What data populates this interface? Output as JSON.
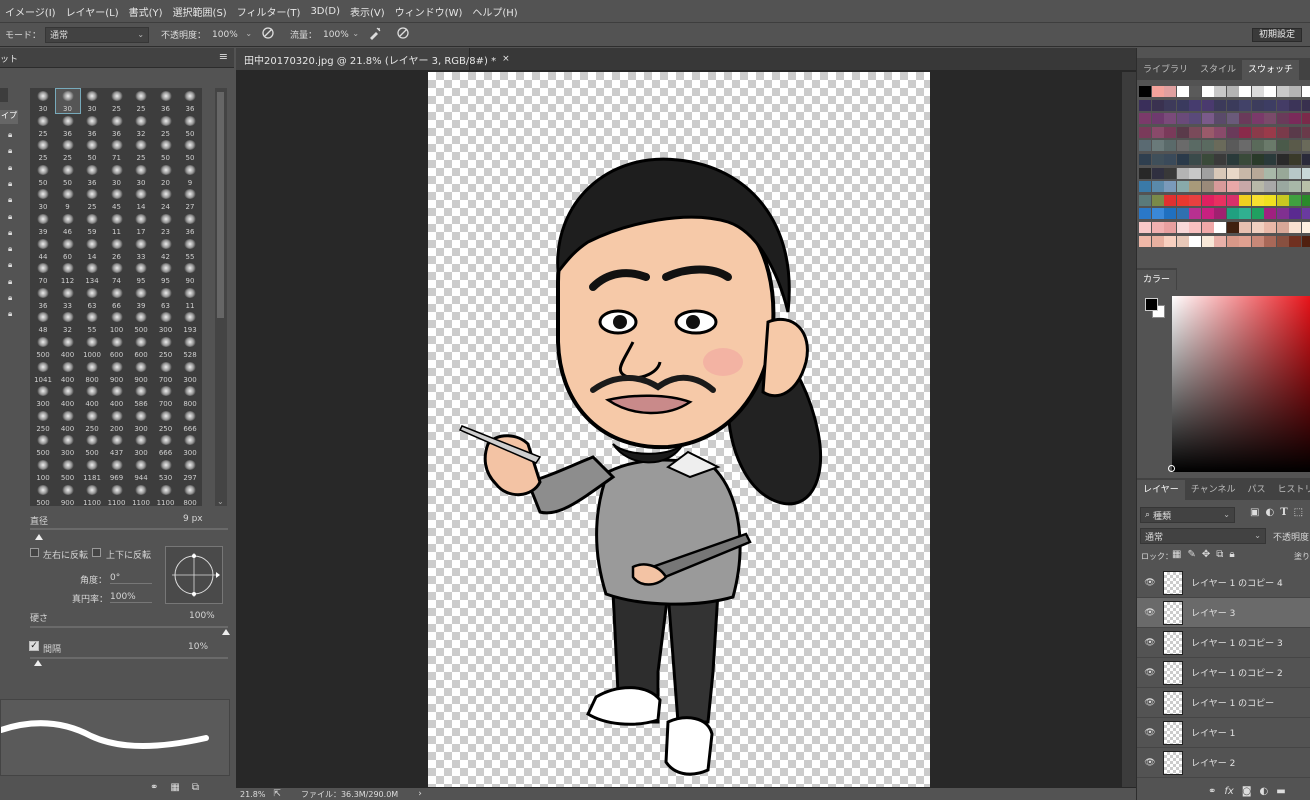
{
  "menu": [
    "イメージ(I)",
    "レイヤー(L)",
    "書式(Y)",
    "選択範囲(S)",
    "フィルター(T)",
    "3D(D)",
    "表示(V)",
    "ウィンドウ(W)",
    "ヘルプ(H)"
  ],
  "options_bar": {
    "mode_label": "モード：",
    "mode_value": "通常",
    "opacity_label": "不透明度：",
    "opacity_value": "100%",
    "flow_label": "流量：",
    "flow_value": "100%",
    "reset_button": "初期設定"
  },
  "document": {
    "tab_title": "田中20170320.jpg @ 21.8% (レイヤー 3, RGB/8#) *",
    "close": "×",
    "zoom": "21.8%",
    "file_info": "ファイル：36.3M/290.0M"
  },
  "brush_panel": {
    "header_left": "ット",
    "sizes": [
      "30",
      "30",
      "30",
      "25",
      "25",
      "36",
      "36",
      "25",
      "36",
      "36",
      "36",
      "32",
      "25",
      "50",
      "25",
      "25",
      "50",
      "71",
      "25",
      "50",
      "50",
      "50",
      "50",
      "36",
      "30",
      "30",
      "20",
      "9",
      "30",
      "9",
      "25",
      "45",
      "14",
      "24",
      "27",
      "39",
      "46",
      "59",
      "11",
      "17",
      "23",
      "36",
      "44",
      "60",
      "14",
      "26",
      "33",
      "42",
      "55",
      "70",
      "112",
      "134",
      "74",
      "95",
      "95",
      "90",
      "36",
      "33",
      "63",
      "66",
      "39",
      "63",
      "11",
      "48",
      "32",
      "55",
      "100",
      "500",
      "300",
      "193",
      "500",
      "400",
      "1000",
      "600",
      "600",
      "250",
      "528",
      "1041",
      "400",
      "800",
      "900",
      "900",
      "700",
      "300",
      "300",
      "400",
      "400",
      "400",
      "586",
      "700",
      "800",
      "250",
      "400",
      "250",
      "200",
      "300",
      "250",
      "666",
      "500",
      "300",
      "500",
      "437",
      "300",
      "666",
      "300",
      "100",
      "500",
      "1181",
      "969",
      "944",
      "530",
      "297",
      "500",
      "900",
      "1100",
      "1100",
      "1100",
      "1100",
      "800"
    ],
    "diameter_label": "直径",
    "diameter_value": "9 px",
    "flip_x_label": "左右に反転",
    "flip_y_label": "上下に反転",
    "angle_label": "角度：",
    "angle_value": "0°",
    "roundness_label": "真円率：",
    "roundness_value": "100%",
    "hardness_label": "硬さ",
    "hardness_value": "100%",
    "spacing_label": "間隔",
    "spacing_value": "10%",
    "spacing_checked": true,
    "side_label": "イプ"
  },
  "swatches_panel": {
    "tabs": [
      "ライブラリ",
      "スタイル",
      "スウォッチ"
    ],
    "active_tab": "スウォッチ",
    "rows": [
      [
        "#000000",
        "#f3a29b",
        "#e0a0a0",
        "#ffffff",
        "#5a5a5a",
        "#ffffff",
        "#c8c8c8",
        "#b4b4b4",
        "#ffffff",
        "#dcdcdc",
        "#ffffff",
        "#c8c8c8",
        "#b4b4b4",
        "#ffffff"
      ],
      [
        "#3a2f5a",
        "#3a3250",
        "#3d3a5a",
        "#3a3a5e",
        "#463c6e",
        "#4a3a6e",
        "#3c3a5a",
        "#3b3b5b",
        "#424268",
        "#3c3c5c",
        "#3d3d63",
        "#443c66",
        "#3c3458",
        "#38304e"
      ],
      [
        "#7b3a6a",
        "#6e3a6e",
        "#7a4a7a",
        "#6a4a7a",
        "#5a4a7a",
        "#7a5a8a",
        "#5a4a6a",
        "#6a5a7a",
        "#6a3a5a",
        "#7a3a6a",
        "#7a4a6a",
        "#6a3a5a",
        "#7a2a5a",
        "#7a2a4a"
      ],
      [
        "#7a3a5a",
        "#8a4a6a",
        "#7a3a5a",
        "#5a3a4a",
        "#7a4a5a",
        "#9a5a6a",
        "#8a4a6a",
        "#6a3a5a",
        "#8a2a4a",
        "#8a3a4a",
        "#9a3a4a",
        "#7a3a4a",
        "#5a3a4a",
        "#6a3a4a"
      ],
      [
        "#5a6a72",
        "#6a7a7a",
        "#5a6a6a",
        "#6a6a6a",
        "#5a6a64",
        "#5a6a60",
        "#6a6a5a",
        "#5a5a5a",
        "#6a6a6a",
        "#5a6a5a",
        "#6a7a6a",
        "#4a5a4a",
        "#5a5a4a",
        "#6a6a5a"
      ],
      [
        "#2f3f4f",
        "#3f4f5a",
        "#3a4a5a",
        "#2a3a4a",
        "#3a4a4a",
        "#3a4a3a",
        "#3a3a3a",
        "#2a3a3a",
        "#3a4a3a",
        "#2a3a2a",
        "#2a3a3a",
        "#2a2a2a",
        "#3a3a2a",
        "#2a2a3a"
      ],
      [
        "#282828",
        "#303040",
        "#383838",
        "#b4b4b4",
        "#c8c8c8",
        "#a0a0a0",
        "#d8c8b8",
        "#e8d8c8",
        "#c8b8a8",
        "#b8a898",
        "#a8b8a8",
        "#98a898",
        "#b8c8c8",
        "#c8d8d8"
      ],
      [
        "#3a7aa8",
        "#5a8aaa",
        "#7a9aba",
        "#8aa",
        "#a89a7a",
        "#9a8a7a",
        "#d89a9a",
        "#e8a8a8",
        "#c8a8a8",
        "#b8b8a8",
        "#a8a8a8",
        "#9aa8a0",
        "#a8b8a8",
        "#b8c0a8"
      ],
      [
        "#5a7a7a",
        "#7a8a4a",
        "#e03030",
        "#e83830",
        "#e84040",
        "#e02060",
        "#e83060",
        "#d8306a",
        "#f0d020",
        "#f8e030",
        "#f0e020",
        "#c8c820",
        "#40a040",
        "#2a8a2a"
      ],
      [
        "#2a78c8",
        "#3a88d8",
        "#2070c0",
        "#3070b0",
        "#b83090",
        "#c82080",
        "#a02070",
        "#20a080",
        "#30b090",
        "#20a060",
        "#a02080",
        "#803090",
        "#5a2a90",
        "#6a3aa0"
      ],
      [
        "#f8c8c8",
        "#f0b0b0",
        "#e8a0a0",
        "#f8d8d8",
        "#f8c0c0",
        "#f0a8a8",
        "#ffffff",
        "#402010",
        "#e8c0b0",
        "#f0d0c0",
        "#e8b8a8",
        "#d8a898",
        "#f8e0d0",
        "#fff0e0"
      ],
      [
        "#f0b8a8",
        "#e8b0a0",
        "#f8d0c0",
        "#e8c8b8",
        "#ffffff",
        "#f8e8d8",
        "#e8b0a8",
        "#d89888",
        "#e0a090",
        "#c88878",
        "#a86858",
        "#885040",
        "#703020",
        "#502010"
      ]
    ],
    "fg_color": "#000000",
    "bg_color": "#ffffff"
  },
  "color_panel": {
    "tab": "カラー",
    "hue": "#e8141a"
  },
  "layers_panel": {
    "tabs": [
      "レイヤー",
      "チャンネル",
      "パス",
      "ヒストリー"
    ],
    "active_tab": "レイヤー",
    "filter_value": "種類",
    "blend_mode": "通常",
    "opacity_label": "不透明度",
    "lock_label": "ロック：",
    "fill_label": "塗り",
    "layers": [
      {
        "name": "レイヤー 1 のコピー 4",
        "selected": false
      },
      {
        "name": "レイヤー 3",
        "selected": true
      },
      {
        "name": "レイヤー 1 のコピー 3",
        "selected": false
      },
      {
        "name": "レイヤー 1 のコピー 2",
        "selected": false
      },
      {
        "name": "レイヤー 1 のコピー",
        "selected": false
      },
      {
        "name": "レイヤー 1",
        "selected": false
      },
      {
        "name": "レイヤー 2",
        "selected": false
      }
    ],
    "footer_icons": [
      "link-icon",
      "fx-icon",
      "mask-icon",
      "adjustment-icon",
      "folder-icon",
      "new-layer-icon",
      "trash-icon"
    ]
  }
}
